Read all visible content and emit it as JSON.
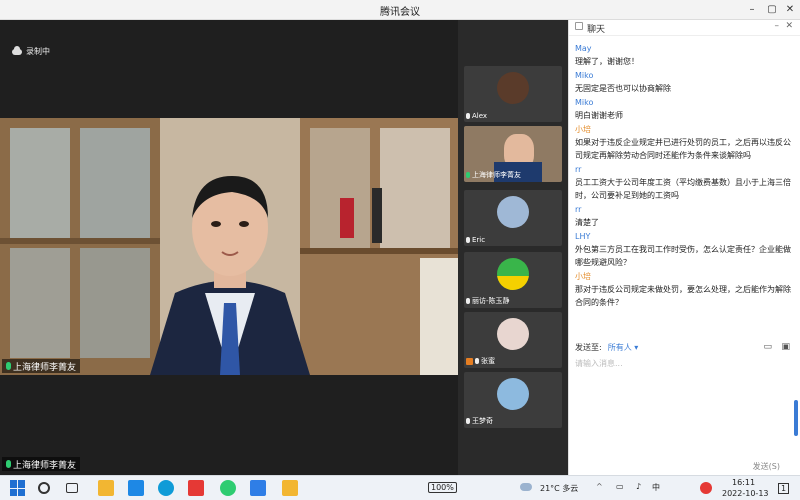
{
  "window": {
    "title": "腾讯会议"
  },
  "recording": {
    "label": "录制中"
  },
  "main_video": {
    "speaker_label": "上海律师李菁友"
  },
  "participants": [
    {
      "name": "Alex",
      "avatar_color": "#5a3b2a"
    },
    {
      "name": "上海律师李菁友",
      "avatar_color": "#1e3a6d"
    },
    {
      "name": "Eric",
      "avatar_color": "#9fb8d6"
    },
    {
      "name": "丽访-陈玉静",
      "avatar_color": "#39b54a"
    },
    {
      "name": "张蜜",
      "avatar_color": "#e8d6d0"
    },
    {
      "name": "王梦奇",
      "avatar_color": "#8dbadf"
    }
  ],
  "chat": {
    "title": "聊天",
    "messages": [
      {
        "sender": "May",
        "text": "理解了，谢谢您！"
      },
      {
        "sender": "Miko",
        "text": "无固定是否也可以协商解除"
      },
      {
        "sender": "Miko",
        "text": "明白谢谢老师"
      },
      {
        "sender": "小培",
        "text": "如果对于违反企业规定并已进行处罚的员工，之后再以违反公司规定再解除劳动合同时还能作为条件来谈解除吗"
      },
      {
        "sender": "rr",
        "text": "员工工资大于公司年度工资（平均缴费基数）且小于上海三倍时，公司要补足到她的工资吗"
      },
      {
        "sender": "rr",
        "text": "清楚了"
      },
      {
        "sender": "LHY",
        "text": "外包第三方员工在我司工作时受伤，怎么认定责任？企业能做哪些规避风险？"
      },
      {
        "sender": "小培",
        "text": "那对于违反公司规定未做处罚，要怎么处理，之后能作为解除合同的条件？"
      }
    ],
    "send_to_label": "发送至:",
    "send_to_value": "所有人",
    "input_placeholder": "请输入消息...",
    "send_button": "发送(S)"
  },
  "taskbar": {
    "battery": "100%",
    "weather": "21°C 多云",
    "ime": "中",
    "time": "16:11",
    "date": "2022-10-13",
    "notif_count": "1"
  },
  "colors": {
    "accent": "#3a7bd5",
    "orange_sender": "#e48d2b",
    "mic_active": "#2ecc71"
  }
}
